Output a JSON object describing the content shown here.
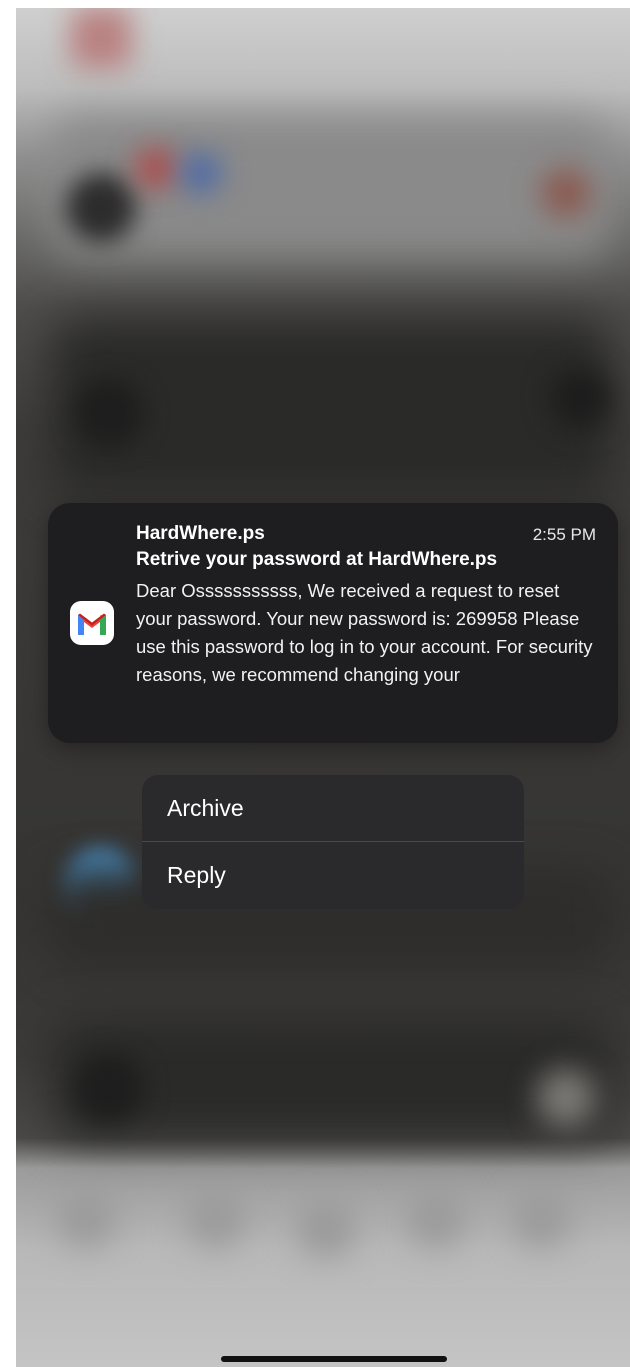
{
  "notification": {
    "app_icon": "gmail-icon",
    "sender": "HardWhere.ps",
    "time": "2:55 PM",
    "subject": "Retrive your password at HardWhere.ps",
    "body": "Dear Osssssssssss, We received a request to reset your password. Your new password is: 269958 Please use this password to log in to your account. For security reasons, we recommend changing your"
  },
  "actions": {
    "archive_label": "Archive",
    "reply_label": "Reply"
  },
  "colors": {
    "notification_bg": "#1e1e20",
    "menu_bg": "#2a2a2c",
    "gmail_red": "#ea4335",
    "gmail_blue": "#4285f4",
    "gmail_green": "#34a853",
    "gmail_yellow": "#fbbc04"
  }
}
